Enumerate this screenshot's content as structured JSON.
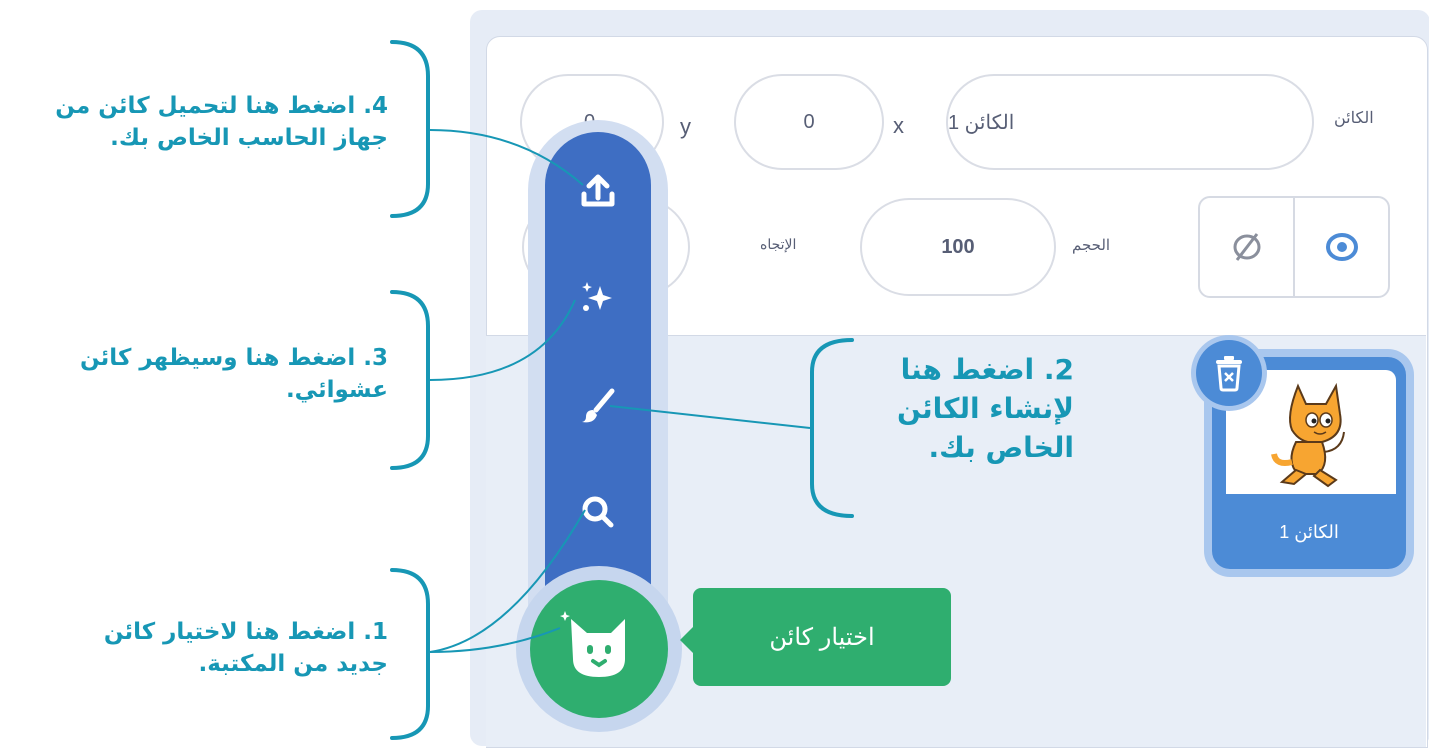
{
  "sprite_info": {
    "sprite_label": "الكائن",
    "sprite_name": "الكائن 1",
    "x_label": "x",
    "x_value": "0",
    "y_label": "y",
    "y_value": "0",
    "size_label": "الحجم",
    "size_value": "100",
    "direction_label": "الإتجاه",
    "direction_value": "",
    "show_icon": "eye-icon",
    "hide_icon": "eye-slash-icon"
  },
  "sprite_list": {
    "items": [
      {
        "name": "الكائن 1",
        "thumbnail": "scratch-cat"
      }
    ],
    "delete_icon": "trash-icon"
  },
  "sprite_menu": {
    "items": [
      {
        "icon": "upload-icon"
      },
      {
        "icon": "surprise-icon"
      },
      {
        "icon": "paint-icon"
      },
      {
        "icon": "search-icon"
      }
    ],
    "main_icon": "cat-icon",
    "tooltip": "اختيار كائن"
  },
  "annotations": {
    "a1": "1. اضغط هنا لاختيار كائن جديد من المكتبة.",
    "a2": "2. اضغط هنا لإنشاء الكائن الخاص بك.",
    "a3": "3. اضغط هنا وسيظهر كائن عشوائي.",
    "a4": "4. اضغط هنا لتحميل كائن من جهاز الحاسب الخاص بك."
  },
  "colors": {
    "menu_blue": "#3e6ec3",
    "choose_green": "#2fae6f",
    "annotation_teal": "#1797b5"
  }
}
